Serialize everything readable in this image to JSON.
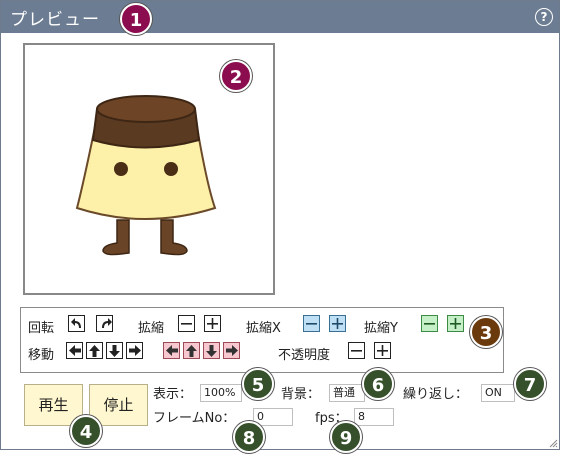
{
  "window": {
    "title": "プレビュー",
    "help_glyph": "?"
  },
  "controls": {
    "rotate_label": "回転",
    "scale_label": "拡縮",
    "scale_x_label": "拡縮X",
    "scale_y_label": "拡縮Y",
    "move_label": "移動",
    "opacity_label": "不透明度"
  },
  "buttons": {
    "play": "再生",
    "stop": "停止"
  },
  "fields": {
    "display_label": "表示：",
    "display_value": "100%",
    "background_label": "背景：",
    "background_value": "普通",
    "repeat_label": "繰り返し：",
    "repeat_value": "ON",
    "frame_label": "フレームNo：",
    "frame_value": "0",
    "fps_label": "fps：",
    "fps_value": "8"
  },
  "badges": [
    {
      "num": "1",
      "color": "#8b0d4f"
    },
    {
      "num": "2",
      "color": "#8b0d4f"
    },
    {
      "num": "3",
      "color": "#6b3a0c"
    },
    {
      "num": "4",
      "color": "#35502a"
    },
    {
      "num": "5",
      "color": "#35502a"
    },
    {
      "num": "6",
      "color": "#35502a"
    },
    {
      "num": "7",
      "color": "#35502a"
    },
    {
      "num": "8",
      "color": "#35502a"
    },
    {
      "num": "9",
      "color": "#35502a"
    }
  ],
  "colors": {
    "titlebar": "#6c7d93",
    "pudding_body": "#fdf0a8",
    "caramel": "#5b3a22",
    "button_blue": "#bfe0f4",
    "button_green": "#c5efc7",
    "button_pink": "#f7c8cf",
    "play_button": "#fff7cf"
  }
}
